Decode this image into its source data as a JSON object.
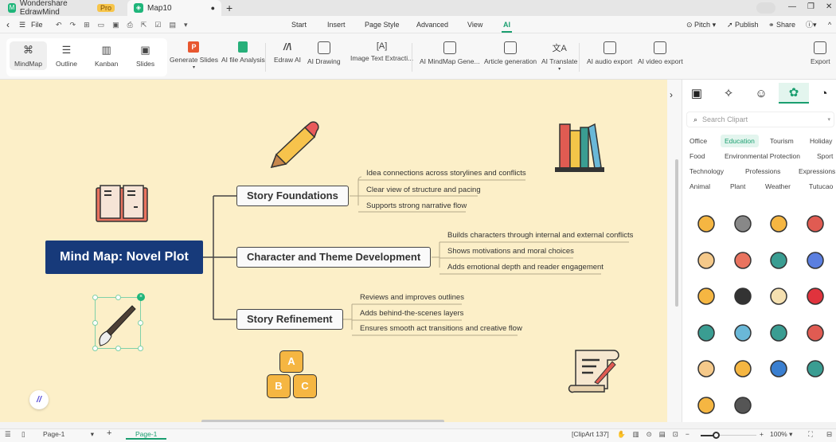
{
  "titlebar": {
    "app_tab": "Wondershare EdrawMind",
    "pro_badge": "Pro",
    "doc_tab": "Map10",
    "new_tab": "+",
    "window_controls": [
      "—",
      "❐",
      "✕"
    ]
  },
  "menubar": {
    "file": "File",
    "tabs": [
      "Start",
      "Insert",
      "Page Style",
      "Advanced",
      "View",
      "AI"
    ],
    "active_tab": "AI",
    "right": {
      "pitch": "Pitch",
      "publish": "Publish",
      "share": "Share",
      "help": "?"
    }
  },
  "ribbon": {
    "views": [
      {
        "label": "MindMap",
        "icon": "mindmap-icon"
      },
      {
        "label": "Outline",
        "icon": "outline-icon"
      },
      {
        "label": "Kanban",
        "icon": "kanban-icon"
      },
      {
        "label": "Slides",
        "icon": "slides-icon"
      }
    ],
    "tools": [
      {
        "label": "Generate Slides",
        "icon": "ppt-icon"
      },
      {
        "label": "AI file Analysis",
        "icon": "file-analysis-icon"
      },
      {
        "label": "Edraw AI",
        "icon": "edraw-ai-icon"
      },
      {
        "label": "AI Drawing",
        "icon": "ai-drawing-icon"
      },
      {
        "label": "Image Text Extracti...",
        "icon": "text-extract-icon"
      },
      {
        "label": "AI MindMap Gene...",
        "icon": "ai-mindmap-icon"
      },
      {
        "label": "Article generation",
        "icon": "article-icon"
      },
      {
        "label": "AI Translate",
        "icon": "translate-icon"
      },
      {
        "label": "AI audio export",
        "icon": "audio-export-icon"
      },
      {
        "label": "AI video export",
        "icon": "video-export-icon"
      }
    ],
    "export": "Export"
  },
  "mindmap": {
    "root": "Mind Map: Novel Plot",
    "branches": [
      {
        "title": "Story Foundations",
        "leaves": [
          "Idea connections across storylines and conflicts",
          "Clear view of structure and pacing",
          "Supports strong narrative flow"
        ]
      },
      {
        "title": "Character and Theme Development",
        "leaves": [
          "Builds characters through internal and external conflicts",
          "Shows motivations and moral choices",
          "Adds emotional depth and reader engagement"
        ]
      },
      {
        "title": "Story Refinement",
        "leaves": [
          "Reviews and improves outlines",
          "Adds behind-the-scenes layers",
          "Ensures smooth act transitions and creative flow"
        ]
      }
    ],
    "clipart": {
      "blocks": [
        "A",
        "B",
        "C"
      ]
    }
  },
  "panel": {
    "search_placeholder": "Search Clipart",
    "categories": [
      "Office",
      "Education",
      "Tourism",
      "Holiday",
      "Food",
      "Environmental Protection",
      "Sport",
      "Technology",
      "Professions",
      "Expressions",
      "Animal",
      "Plant",
      "Weather",
      "Tutucao"
    ],
    "selected_category": "Education",
    "clipart_items": [
      "alarm-clock",
      "glasses",
      "clock",
      "raised-hand",
      "footprint",
      "clipboard",
      "laptop",
      "gamepad",
      "puzzle",
      "graduation-cap",
      "notepad",
      "heart",
      "headset",
      "presentation",
      "picture",
      "bicycle",
      "browser",
      "lightbulb",
      "abacus",
      "fountain-pen",
      "pencil",
      "paintbrush"
    ]
  },
  "statusbar": {
    "page_select": "Page-1",
    "page_tab": "Page-1",
    "add": "+",
    "clipart_count": "[ClipArt 137]",
    "zoom": "100%",
    "zoom_level": 100
  }
}
